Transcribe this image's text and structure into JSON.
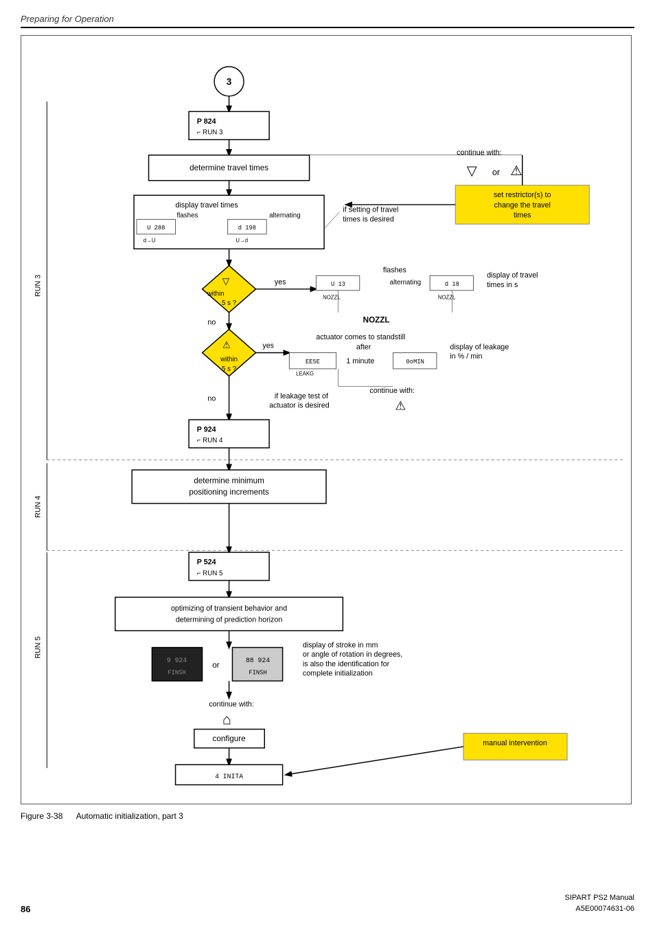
{
  "header": {
    "title": "Preparing for Operation"
  },
  "figure": {
    "caption_prefix": "Figure 3-38",
    "caption_text": "Automatic initialization, part 3"
  },
  "footer": {
    "page_number": "86",
    "product": "SIPART PS2  Manual",
    "doc_number": "A5E00074631-06"
  },
  "diagram": {
    "nodes": {
      "circle3_label": "3",
      "p824_label": "P 824",
      "run3_label": "RUN 3",
      "determine_travel": "determine travel times",
      "display_travel": "display travel times",
      "flashes_label": "flashes",
      "alternating_label": "alternating",
      "if_setting": "if setting of travel\ntimes is desired",
      "continue_with": "continue with:",
      "set_restrictor": "set restrictor(s) to\nchange the travel\ntimes",
      "within_5s_1": "within\n5 s ?",
      "yes1": "yes",
      "no1": "no",
      "flashes2": "flashes",
      "alternating2": "alternating",
      "display_travel_s": "display of travel\ntimes in s",
      "nozzl_label": "NOZZL",
      "within_5s_2": "within\n5 s ?",
      "yes2": "yes",
      "no2": "no",
      "actuator_standstill": "actuator comes to standstill",
      "after_label": "after",
      "leakage_test": "if leakage test of\nactuator is desired",
      "display_leakage": "display of leakage\nin % / min",
      "continue_with2": "continue with:",
      "p924_label": "P 924",
      "run4_label": "RUN 4",
      "determine_pos": "determine minimum\npositioning increments",
      "p524_label": "P 524",
      "run5_label": "RUN 5",
      "run5_text": "RUN 5",
      "optimizing": "optimizing of transient behavior and\ndetermining of prediction horizon",
      "display_stroke": "display of stroke in mm\nor angle of rotation in degrees,\nis also the identification for\ncomplete initialization",
      "continue_with3": "continue with:",
      "configure_label": "configure",
      "inita_label": "4  INITA",
      "manual_intervention": "manual intervention",
      "run3_side": "RUN 3",
      "run4_side": "RUN 4",
      "run5_side": "RUN 5",
      "1_minute": "1 minute"
    }
  }
}
